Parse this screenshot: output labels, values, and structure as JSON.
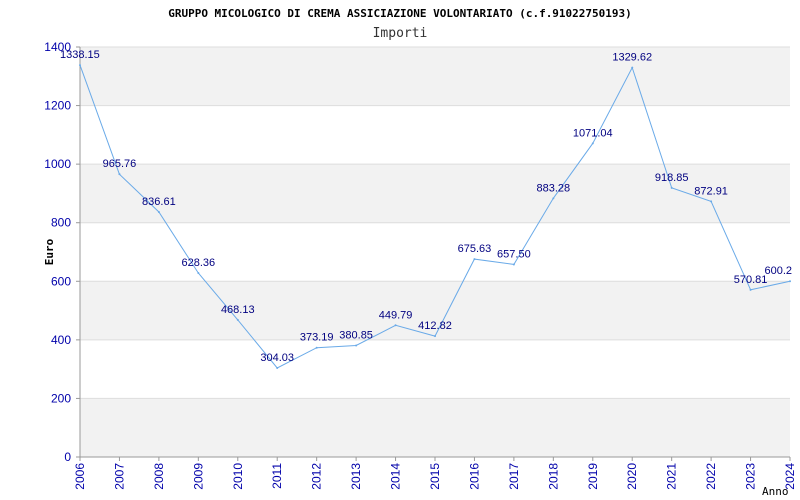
{
  "chart_data": {
    "type": "line",
    "title": "GRUPPO MICOLOGICO DI CREMA ASSICIAZIONE VOLONTARIATO (c.f.91022750193)",
    "subtitle": "Importi",
    "xlabel": "Anno",
    "ylabel": "Euro",
    "ylim": [
      0,
      1400
    ],
    "yticks": [
      0,
      200,
      400,
      600,
      800,
      1000,
      1200,
      1400
    ],
    "grid": "horizontal alternating bands",
    "line_color": "#6aaae8",
    "band_color": "#f2f2f2",
    "tick_color": "#0000aa",
    "label_color": "#000080",
    "categories": [
      "2006",
      "2007",
      "2008",
      "2009",
      "2010",
      "2011",
      "2012",
      "2013",
      "2014",
      "2015",
      "2016",
      "2017",
      "2018",
      "2019",
      "2020",
      "2021",
      "2022",
      "2023",
      "2024"
    ],
    "series": [
      {
        "values": [
          1338.15,
          965.76,
          836.61,
          628.36,
          468.13,
          304.03,
          373.19,
          380.85,
          449.79,
          412.82,
          675.63,
          657.5,
          883.28,
          1071.04,
          1329.62,
          918.85,
          872.91,
          570.81,
          600.2
        ],
        "labels": [
          "1338.15",
          "965.76",
          "836.61",
          "628.36",
          "468.13",
          "304.03",
          "373.19",
          "380.85",
          "449.79",
          "412.82",
          "675.63",
          "657.50",
          "883.28",
          "1071.04",
          "1329.62",
          "918.85",
          "872.91",
          "570.81",
          "600.2"
        ]
      }
    ]
  }
}
